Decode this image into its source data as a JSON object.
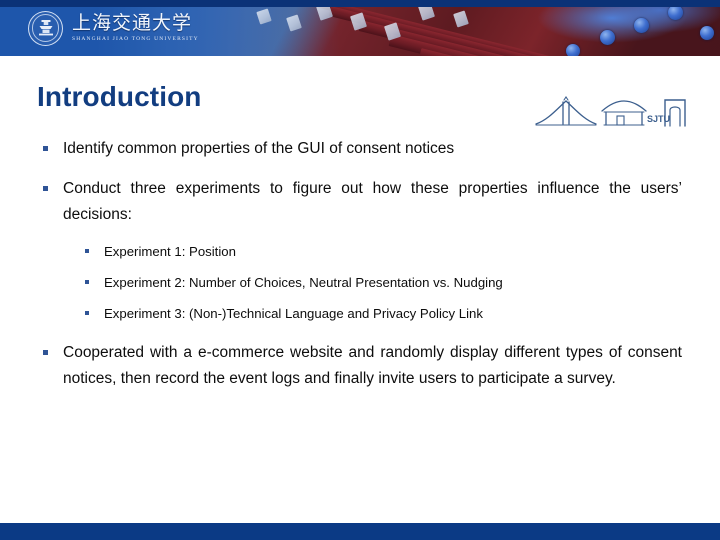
{
  "header": {
    "logo": {
      "seal_name": "university-seal-emblem",
      "chinese_name": "上海交通大学",
      "english_name": "SHANGHAI JIAO TONG UNIVERSITY"
    },
    "background_image": "traditional-chinese-roof-eave-photo",
    "colors": {
      "band_top": "#0b3277",
      "band_main": "#1e56ab",
      "roof_red": "#6a1b24",
      "ornament_blue": "#3f6fd0"
    }
  },
  "slide": {
    "title": "Introduction",
    "title_color": "#123d80",
    "decoration": {
      "name": "sjtu-skyline-mark",
      "label": "SJTU",
      "elements": [
        "suspension-bridge",
        "pavilion-gate",
        "campus-archway"
      ],
      "color": "#3c5f8e"
    },
    "bullets": [
      {
        "level": 1,
        "text": "Identify common properties of the GUI of consent notices"
      },
      {
        "level": 1,
        "text": "Conduct three experiments to figure out how these properties influence the users’ decisions:"
      },
      {
        "level": 2,
        "text": "Experiment 1: Position"
      },
      {
        "level": 2,
        "text": "Experiment 2: Number of Choices, Neutral Presentation vs. Nudging"
      },
      {
        "level": 2,
        "text": "Experiment 3: (Non-)Technical Language and Privacy Policy Link"
      },
      {
        "level": 1,
        "text": "Cooperated with a e-commerce website and randomly display different types of consent notices, then record the event logs and finally invite users to participate a survey."
      }
    ],
    "bullet_marker_color": "#2f5496",
    "body_text_color": "#0d0d0d"
  },
  "footer": {
    "color": "#0b3a85"
  }
}
